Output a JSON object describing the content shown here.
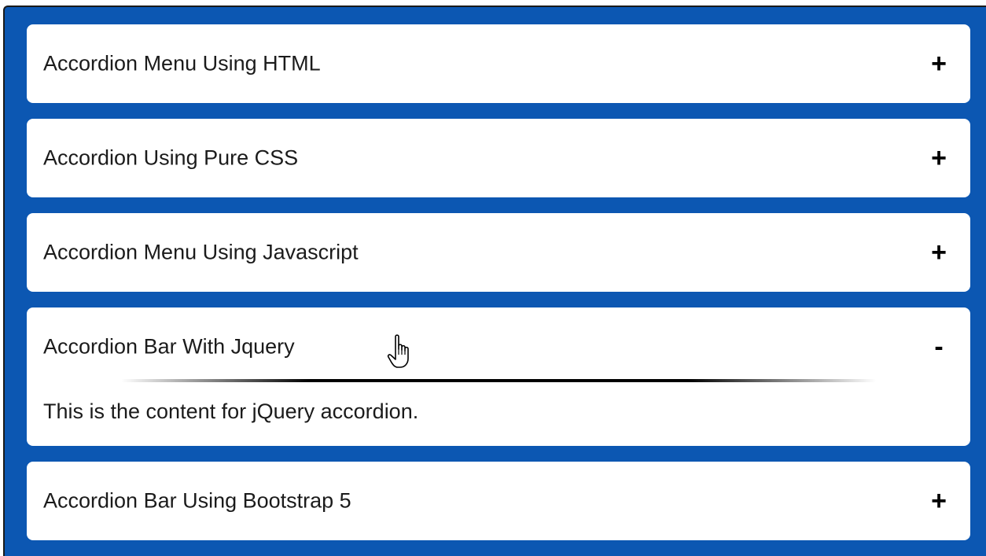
{
  "accordion": {
    "items": [
      {
        "title": "Accordion Menu Using HTML",
        "toggle": "+",
        "expanded": false
      },
      {
        "title": "Accordion Using Pure CSS",
        "toggle": "+",
        "expanded": false
      },
      {
        "title": "Accordion Menu Using Javascript",
        "toggle": "+",
        "expanded": false
      },
      {
        "title": "Accordion Bar With Jquery",
        "toggle": "-",
        "expanded": true,
        "content": "This is the content for jQuery accordion."
      },
      {
        "title": "Accordion Bar Using Bootstrap 5",
        "toggle": "+",
        "expanded": false
      }
    ]
  },
  "colors": {
    "frame_background": "#0c57b2",
    "panel_background": "#ffffff",
    "text": "#1b1b1b"
  },
  "cursor": {
    "icon": "hand-pointer-icon"
  }
}
